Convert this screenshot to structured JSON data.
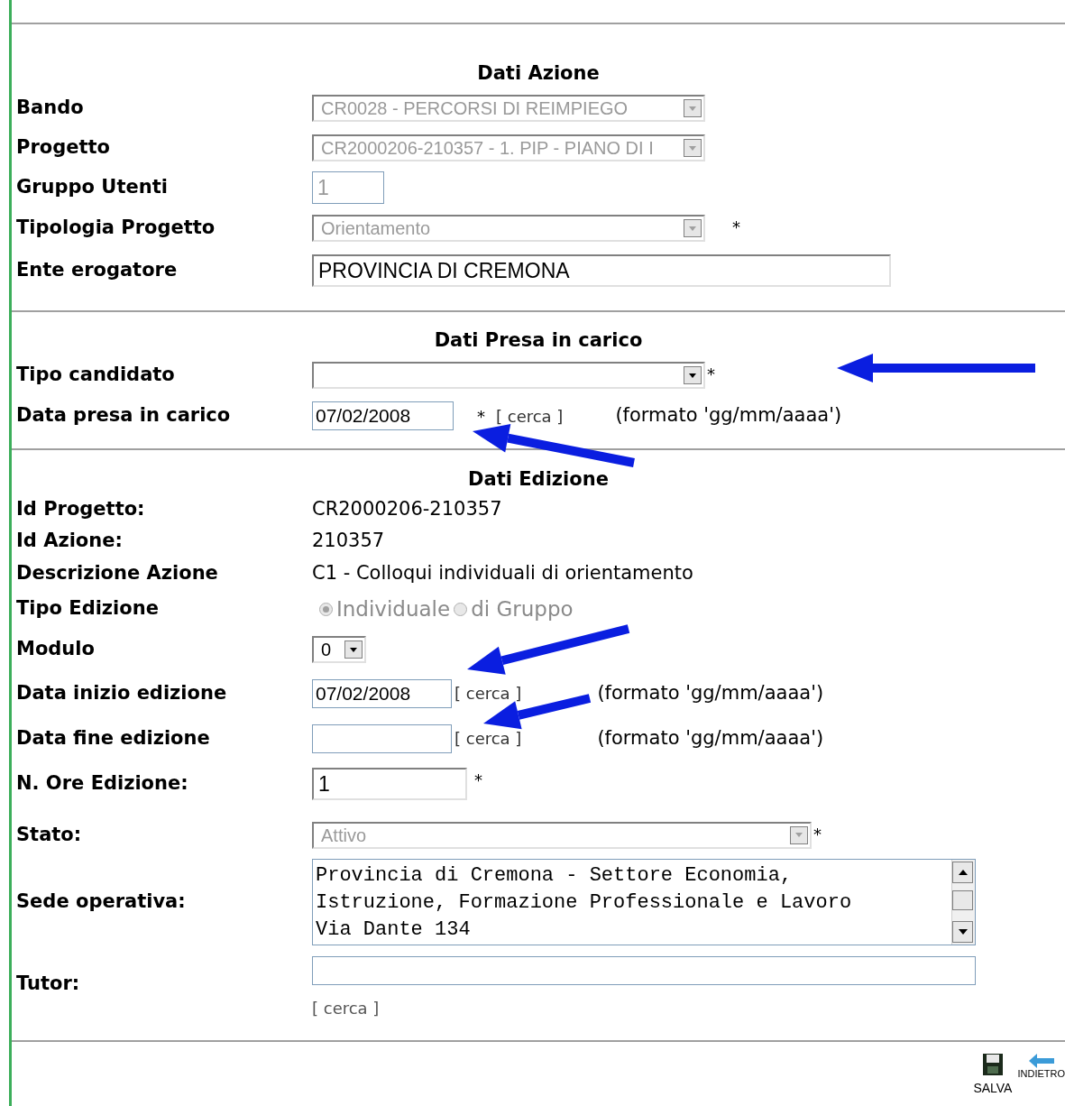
{
  "sections": [
    {
      "title": "Dati Azione",
      "rows": [
        {
          "label": "Bando",
          "kind": "select",
          "value": "CR0028 - PERCORSI DI REIMPIEGO",
          "disabled": true,
          "required": false
        },
        {
          "label": "Progetto",
          "kind": "select",
          "value": "CR2000206-210357 - 1. PIP - PIANO DI I",
          "disabled": true,
          "required": false
        },
        {
          "label": "Gruppo Utenti",
          "kind": "input",
          "value": "1",
          "disabled": true,
          "required": false
        },
        {
          "label": "Tipologia Progetto",
          "kind": "select",
          "value": "Orientamento",
          "disabled": true,
          "required": true,
          "required_mark": "*"
        },
        {
          "label": "Ente erogatore",
          "kind": "input",
          "value": "PROVINCIA DI CREMONA",
          "disabled": false,
          "required": false
        }
      ]
    },
    {
      "title": "Dati Presa in carico",
      "rows": [
        {
          "label": "Tipo candidato",
          "kind": "select",
          "disabled": false,
          "required": true,
          "required_mark": "*"
        },
        {
          "label": "Data presa in carico",
          "kind": "date",
          "value": "07/02/2008",
          "required": true,
          "required_mark": "*",
          "link": "[ cerca ]",
          "hint": "(formato 'gg/mm/aaaa')"
        }
      ]
    },
    {
      "title": "Dati Edizione",
      "rows": [
        {
          "label": "Id Progetto:",
          "kind": "text",
          "value": "CR2000206-210357"
        },
        {
          "label": "Id Azione:",
          "kind": "text",
          "value": "210357"
        },
        {
          "label": "Descrizione Azione",
          "kind": "text",
          "value": "C1 - Colloqui individuali di orientamento"
        },
        {
          "label": "Tipo Edizione",
          "kind": "radio",
          "disabled": true,
          "options": [
            {
              "label": "Individuale",
              "selected": true
            },
            {
              "label": "di Gruppo",
              "selected": false
            }
          ]
        },
        {
          "label": "Modulo",
          "kind": "select",
          "value": "0",
          "disabled": false,
          "required": false
        },
        {
          "label": "Data inizio edizione",
          "kind": "date",
          "value": "07/02/2008",
          "required": false,
          "link": "[ cerca ]",
          "hint": "(formato 'gg/mm/aaaa')"
        },
        {
          "label": "Data fine edizione",
          "kind": "date",
          "required": false,
          "link": "[ cerca ]",
          "hint": "(formato 'gg/mm/aaaa')"
        },
        {
          "label": "N. Ore Edizione:",
          "kind": "input",
          "value": "1",
          "disabled": false,
          "required": true,
          "required_mark": "*"
        },
        {
          "label": "Stato:",
          "kind": "select",
          "value": "Attivo",
          "disabled": true,
          "required": true,
          "required_mark": "*"
        },
        {
          "label": "Sede operativa:",
          "kind": "textarea",
          "lines": [
            "Provincia di Cremona - Settore Economia,",
            "Istruzione, Formazione Professionale e Lavoro",
            "Via Dante 134"
          ]
        },
        {
          "label": "Tutor:",
          "kind": "lookup",
          "link": "[ cerca ]"
        }
      ]
    }
  ],
  "buttons": [
    {
      "label": "SALVA",
      "kind": "save"
    },
    {
      "label": "INDIETRO",
      "kind": "back"
    }
  ]
}
